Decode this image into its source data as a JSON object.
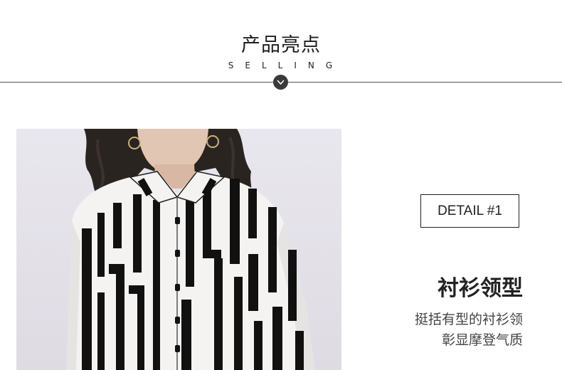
{
  "header": {
    "title": "产品亮点",
    "subtitle": "SELLING"
  },
  "icons": {
    "divider_badge": "chevron-down-icon"
  },
  "detail": {
    "label": "DETAIL #1",
    "title": "衬衫领型",
    "description_lines": [
      "挺括有型的衬衫领",
      "彰显摩登气质"
    ]
  },
  "photo": {
    "subject": "black-white-striped-shirt-model"
  },
  "colors": {
    "badge": "#3a3a3a",
    "text": "#222222",
    "divider": "#555555"
  }
}
